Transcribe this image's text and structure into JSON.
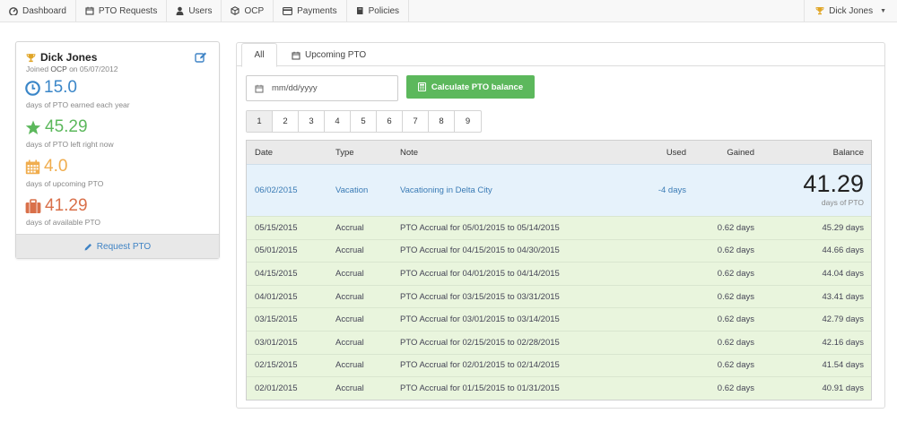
{
  "nav": {
    "items": [
      {
        "label": "Dashboard",
        "icon": "dashboard-icon"
      },
      {
        "label": "PTO Requests",
        "icon": "calendar-icon"
      },
      {
        "label": "Users",
        "icon": "user-icon"
      },
      {
        "label": "OCP",
        "icon": "cube-icon"
      },
      {
        "label": "Payments",
        "icon": "credit-card-icon"
      },
      {
        "label": "Policies",
        "icon": "book-icon"
      }
    ],
    "user_menu": {
      "label": "Dick Jones",
      "icon": "trophy-icon"
    }
  },
  "profile": {
    "name": "Dick Jones",
    "joined_prefix": "Joined ",
    "joined_company": "OCP",
    "joined_suffix": " on 05/07/2012",
    "stats": [
      {
        "value": "15.0",
        "label": "days of PTO earned each year",
        "icon": "clock-icon",
        "color": "#3a86c8"
      },
      {
        "value": "45.29",
        "label": "days of PTO left right now",
        "icon": "star-icon",
        "color": "#5cb85c"
      },
      {
        "value": "4.0",
        "label": "days of upcoming PTO",
        "icon": "calendar-grid-icon",
        "color": "#f0ad4e"
      },
      {
        "value": "41.29",
        "label": "days of available PTO",
        "icon": "suitcase-icon",
        "color": "#d9704a"
      }
    ],
    "request_label": "Request PTO"
  },
  "tabs": {
    "all": "All",
    "upcoming": "Upcoming PTO"
  },
  "date_input": {
    "placeholder": "mm/dd/yyyy"
  },
  "calc_button": "Calculate PTO balance",
  "pagination": {
    "pages": [
      "1",
      "2",
      "3",
      "4",
      "5",
      "6",
      "7",
      "8",
      "9"
    ],
    "active": "1"
  },
  "table": {
    "headers": {
      "date": "Date",
      "type": "Type",
      "note": "Note",
      "used": "Used",
      "gained": "Gained",
      "balance": "Balance"
    },
    "current": {
      "date": "06/02/2015",
      "type": "Vacation",
      "note": "Vacationing in Delta City",
      "used": "-4 days",
      "balance": "41.29",
      "balance_sub": "days of PTO"
    },
    "rows": [
      {
        "date": "05/15/2015",
        "type": "Accrual",
        "note": "PTO Accrual for 05/01/2015 to 05/14/2015",
        "gained": "0.62 days",
        "balance": "45.29 days"
      },
      {
        "date": "05/01/2015",
        "type": "Accrual",
        "note": "PTO Accrual for 04/15/2015 to 04/30/2015",
        "gained": "0.62 days",
        "balance": "44.66 days"
      },
      {
        "date": "04/15/2015",
        "type": "Accrual",
        "note": "PTO Accrual for 04/01/2015 to 04/14/2015",
        "gained": "0.62 days",
        "balance": "44.04 days"
      },
      {
        "date": "04/01/2015",
        "type": "Accrual",
        "note": "PTO Accrual for 03/15/2015 to 03/31/2015",
        "gained": "0.62 days",
        "balance": "43.41 days"
      },
      {
        "date": "03/15/2015",
        "type": "Accrual",
        "note": "PTO Accrual for 03/01/2015 to 03/14/2015",
        "gained": "0.62 days",
        "balance": "42.79 days"
      },
      {
        "date": "03/01/2015",
        "type": "Accrual",
        "note": "PTO Accrual for 02/15/2015 to 02/28/2015",
        "gained": "0.62 days",
        "balance": "42.16 days"
      },
      {
        "date": "02/15/2015",
        "type": "Accrual",
        "note": "PTO Accrual for 02/01/2015 to 02/14/2015",
        "gained": "0.62 days",
        "balance": "41.54 days"
      },
      {
        "date": "02/01/2015",
        "type": "Accrual",
        "note": "PTO Accrual for 01/15/2015 to 01/31/2015",
        "gained": "0.62 days",
        "balance": "40.91 days"
      }
    ]
  }
}
